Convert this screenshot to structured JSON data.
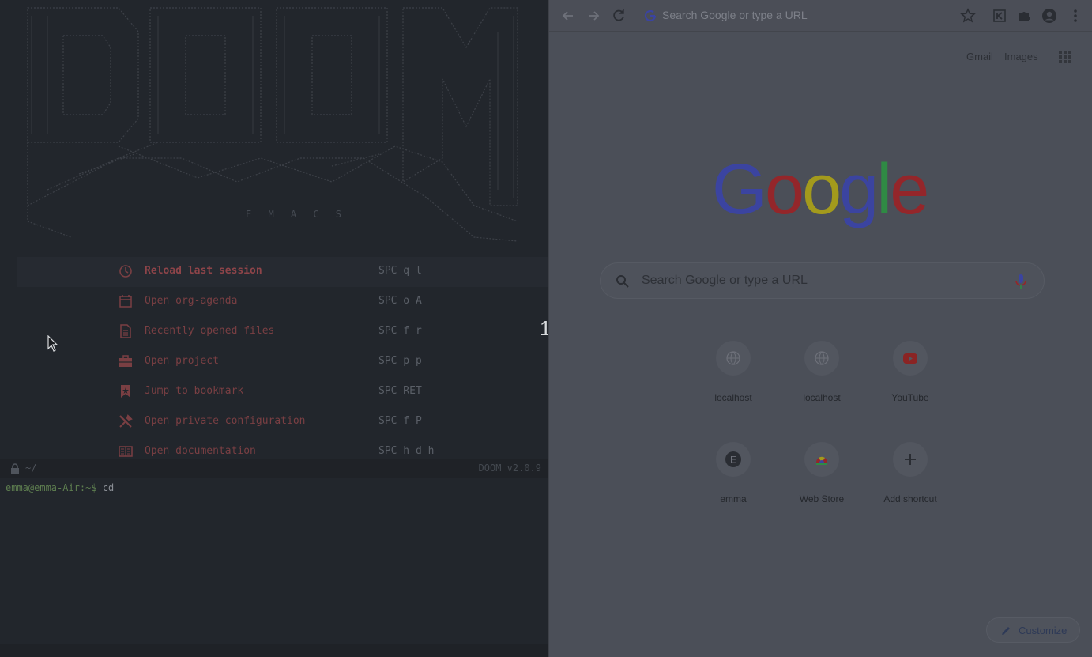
{
  "emacs": {
    "banner_word": "E M A C S",
    "menu": [
      {
        "label": "Reload last session",
        "key": "SPC q l",
        "icon": "reload-icon",
        "active": true
      },
      {
        "label": "Open org-agenda",
        "key": "SPC o A",
        "icon": "calendar-icon"
      },
      {
        "label": "Recently opened files",
        "key": "SPC f r",
        "icon": "file-icon"
      },
      {
        "label": "Open project",
        "key": "SPC p p",
        "icon": "briefcase-icon"
      },
      {
        "label": "Jump to bookmark",
        "key": "SPC RET",
        "icon": "bookmark-icon"
      },
      {
        "label": "Open private configuration",
        "key": "SPC f P",
        "icon": "tools-icon"
      },
      {
        "label": "Open documentation",
        "key": "SPC h d h",
        "icon": "book-icon"
      }
    ],
    "modeline": {
      "path": "~/",
      "version": "DOOM v2.0.9"
    },
    "terminal": {
      "prompt": "emma@emma-Air:~$",
      "command": "cd "
    },
    "divider_number": "1"
  },
  "chrome": {
    "omnibox_placeholder": "Search Google or type a URL",
    "top_links": {
      "gmail": "Gmail",
      "images": "Images"
    },
    "search_placeholder": "Search Google or type a URL",
    "shortcuts": [
      {
        "label": "localhost",
        "icon": "globe-icon"
      },
      {
        "label": "localhost",
        "icon": "globe-icon"
      },
      {
        "label": "YouTube",
        "icon": "youtube-icon"
      },
      {
        "label": "emma",
        "icon": "letter-avatar-icon",
        "letter": "E"
      },
      {
        "label": "Web Store",
        "icon": "webstore-icon"
      },
      {
        "label": "Add shortcut",
        "icon": "plus-icon"
      }
    ],
    "customize_label": "Customize",
    "logo_text": "Google",
    "logo_colors": [
      "#3b44a0",
      "#94262a",
      "#a39a1c",
      "#3b44a0",
      "#2f8a44",
      "#94262a"
    ]
  }
}
